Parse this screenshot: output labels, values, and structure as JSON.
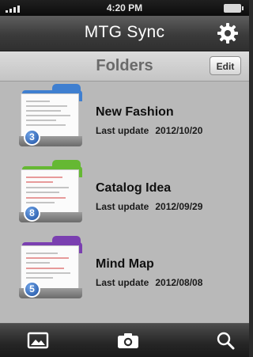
{
  "status_bar": {
    "time": "4:20 PM"
  },
  "header": {
    "title": "MTG Sync"
  },
  "folders_bar": {
    "title": "Folders",
    "edit_label": "Edit"
  },
  "folders": [
    {
      "name": "New Fashion",
      "last_update_label": "Last update",
      "date": "2012/10/20",
      "count": "3",
      "color": "#3f7fd0"
    },
    {
      "name": "Catalog Idea",
      "last_update_label": "Last update",
      "date": "2012/09/29",
      "count": "8",
      "color": "#65b833"
    },
    {
      "name": "Mind Map",
      "last_update_label": "Last update",
      "date": "2012/08/08",
      "count": "5",
      "color": "#7a3fb0"
    }
  ],
  "toolbar": {
    "icons": [
      "photos-icon",
      "camera-icon",
      "search-icon"
    ]
  },
  "colors": {
    "title_bar": "#3f3f3f",
    "list_background": "#b9b9b9",
    "badge": "#2c63b8"
  }
}
